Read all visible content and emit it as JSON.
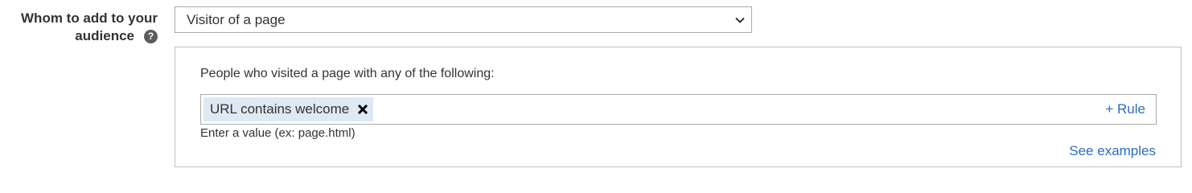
{
  "audience_field": {
    "label_line1": "Whom to add to your",
    "label_line2": "audience",
    "help_icon": "question-circle-icon",
    "help_glyph": "?"
  },
  "audience_select": {
    "selected_value": "Visitor of a page",
    "dropdown_icon": "chevron-down-icon"
  },
  "rule_panel": {
    "heading": "People who visited a page with any of the following:",
    "tokens": [
      {
        "label": "URL contains welcome",
        "remove_icon": "close-icon"
      }
    ],
    "add_rule_label": "+ Rule",
    "hint": "Enter a value (ex: page.html)",
    "see_examples_label": "See examples"
  },
  "colors": {
    "text": "#333333",
    "link": "#2a6ebb",
    "token_bg": "#ddeaf4",
    "border": "#aaaaaa",
    "help_icon_bg": "#5b5b5b"
  }
}
